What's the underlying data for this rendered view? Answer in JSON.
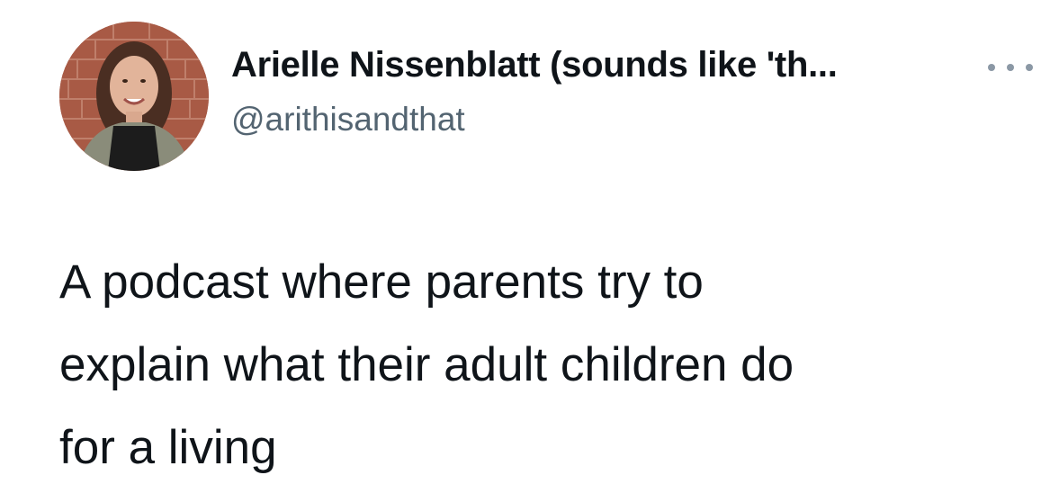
{
  "tweet": {
    "author": {
      "display_name": "Arielle Nissenblatt (sounds like 'th...",
      "handle": "@arithisandthat",
      "avatar_icon": "profile-photo"
    },
    "more_icon": "more-horizontal-icon",
    "text": "A podcast where parents try to\nexplain what their adult children do\nfor a living"
  },
  "colors": {
    "text_primary": "#0f1419",
    "text_secondary": "#536471",
    "background": "#ffffff"
  }
}
